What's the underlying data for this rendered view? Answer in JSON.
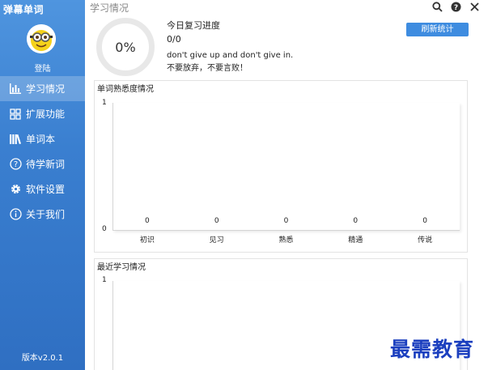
{
  "app": {
    "title": "弹幕单词",
    "version": "版本v2.0.1"
  },
  "sidebar": {
    "login": "登陆",
    "items": [
      {
        "label": "学习情况",
        "icon": "bar-chart-icon",
        "active": true
      },
      {
        "label": "扩展功能",
        "icon": "grid-icon",
        "active": false
      },
      {
        "label": "单词本",
        "icon": "books-icon",
        "active": false
      },
      {
        "label": "待学新词",
        "icon": "question-icon",
        "active": false
      },
      {
        "label": "软件设置",
        "icon": "gear-icon",
        "active": false
      },
      {
        "label": "关于我们",
        "icon": "info-icon",
        "active": false
      }
    ]
  },
  "header": {
    "title": "学习情况"
  },
  "progress": {
    "percent": "0%",
    "value": 0
  },
  "today": {
    "title": "今日复习进度",
    "count": "0/0",
    "motto_en": "don't give up and don't give in.",
    "motto_zh": "不要放弃，不要言败！"
  },
  "refresh_label": "刷新统计",
  "colors": {
    "sidebar": "#3a7fd0",
    "accent": "#3e8ce0",
    "watermark": "#1b3fbf"
  },
  "chart_data": [
    {
      "type": "bar",
      "title": "单词熟悉度情况",
      "categories": [
        "初识",
        "见习",
        "熟悉",
        "精通",
        "传说"
      ],
      "values": [
        0,
        0,
        0,
        0,
        0
      ],
      "ylim": [
        0,
        1
      ],
      "yticks": [
        "0",
        "1"
      ]
    },
    {
      "type": "line",
      "title": "最近学习情况",
      "yticks": [
        "1"
      ]
    }
  ],
  "watermark": "最需教育"
}
